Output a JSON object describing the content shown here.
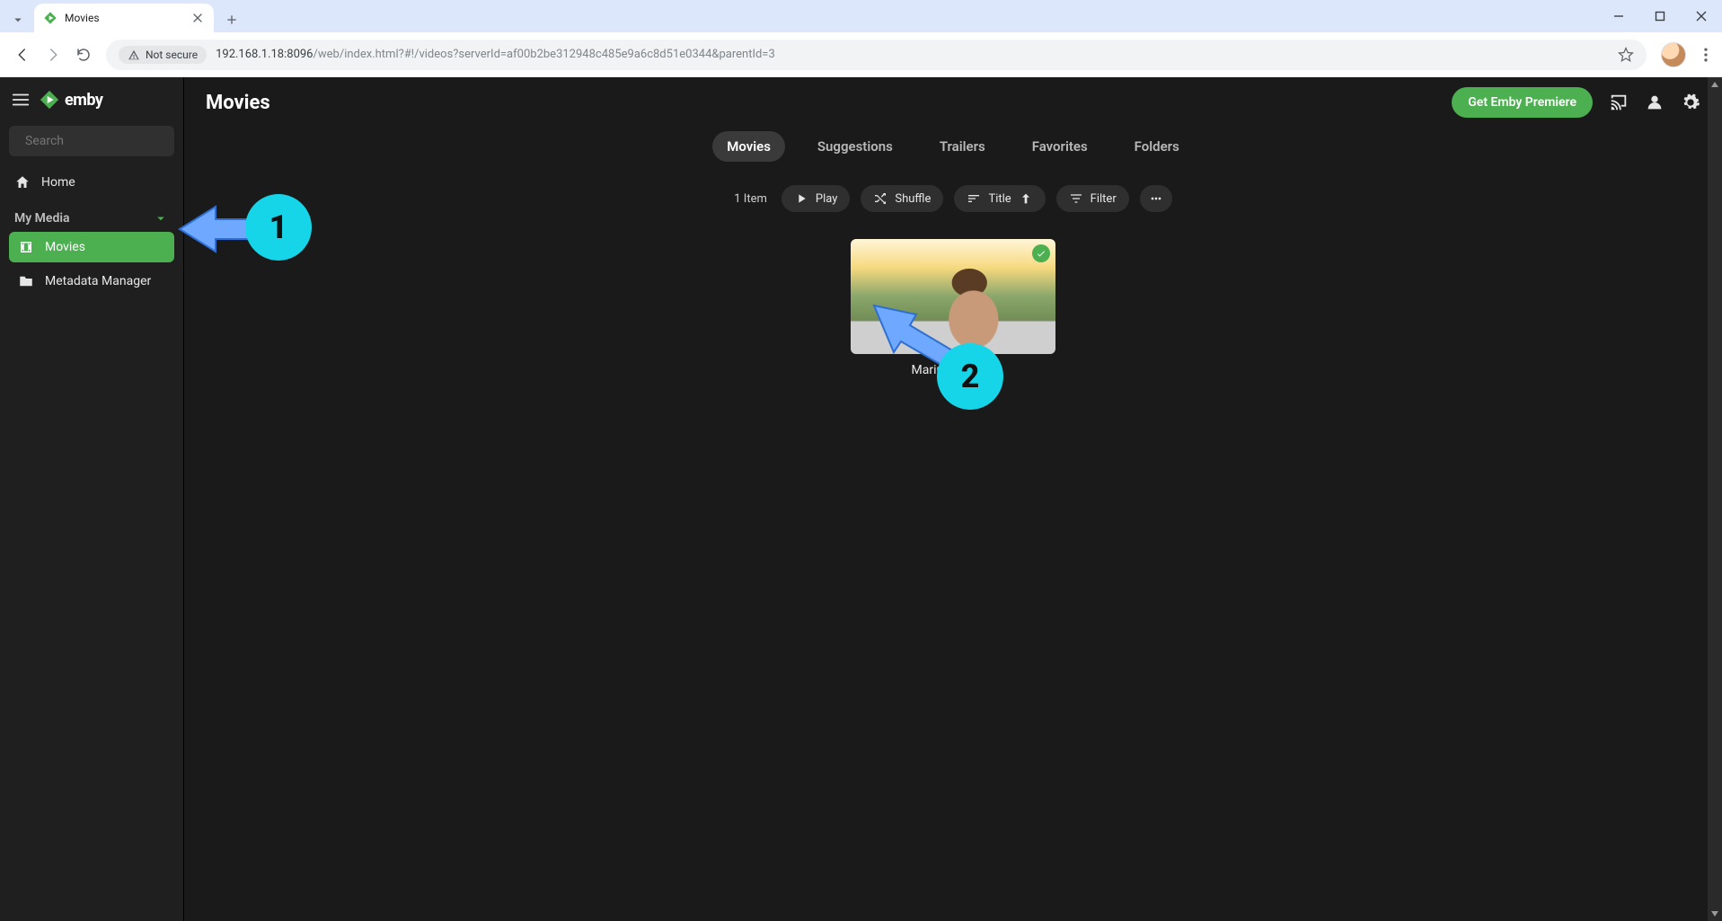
{
  "browser": {
    "tab_title": "Movies",
    "security_label": "Not secure",
    "url_prefix": "192.168.1.18:8096",
    "url_suffix": "/web/index.html?#!/videos?serverId=af00b2be312948c485e9a6c8d51e0344&parentId=3"
  },
  "sidebar": {
    "brand": "emby",
    "search_placeholder": "Search",
    "home_label": "Home",
    "section_label": "My Media",
    "items": [
      {
        "label": "Movies",
        "active": true
      },
      {
        "label": "Metadata Manager",
        "active": false
      }
    ]
  },
  "header": {
    "title": "Movies",
    "premiere_label": "Get Emby Premiere"
  },
  "tabs": [
    {
      "label": "Movies",
      "active": true
    },
    {
      "label": "Suggestions",
      "active": false
    },
    {
      "label": "Trailers",
      "active": false
    },
    {
      "label": "Favorites",
      "active": false
    },
    {
      "label": "Folders",
      "active": false
    }
  ],
  "toolbar": {
    "count_label": "1 Item",
    "play_label": "Play",
    "shuffle_label": "Shuffle",
    "sort_label": "Title",
    "filter_label": "Filter"
  },
  "cards": [
    {
      "title": "Marius hosting",
      "watched": true
    }
  ],
  "annotations": {
    "one": "1",
    "two": "2"
  },
  "colors": {
    "accent": "#4caf50",
    "annotation": "#17d5e8",
    "arrow_fill": "#6fa8ff",
    "arrow_stroke": "#2f6fd1"
  }
}
